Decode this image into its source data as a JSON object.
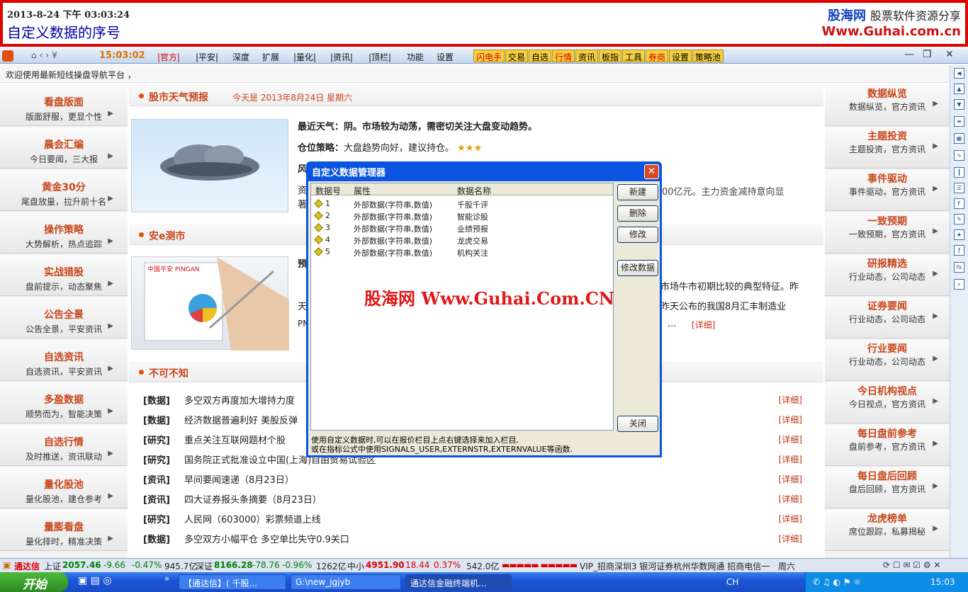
{
  "banner": {
    "date": "2013-8-24 下午 03:03:24",
    "title": "自定义数据的序号",
    "logo_name": "股海网",
    "logo_slogan": "股票软件资源分享",
    "logo_url": "Www.Guhai.com.cn"
  },
  "menubar": {
    "clock": "15:03:02",
    "items": [
      "|官方|",
      "|平安|",
      "深度",
      "扩展",
      "|量化|",
      "|资讯|",
      "|顶栏|",
      "功能",
      "设置"
    ],
    "quick": [
      "闪电手",
      "交易",
      "自选",
      "行情",
      "资讯",
      "板指",
      "工具",
      "券商",
      "设置",
      "策略池"
    ]
  },
  "welcome": "欢迎使用最新短线操盘导航平台 ，",
  "left_nav": [
    {
      "t": "看盘版面",
      "s": "版面舒服，更显个性"
    },
    {
      "t": "晨会汇编",
      "s": "今日要闻，三大报"
    },
    {
      "t": "黄金30分",
      "s": "尾盘放量，拉升前十名"
    },
    {
      "t": "操作策略",
      "s": "大势解析，热点追踪"
    },
    {
      "t": "实战猎股",
      "s": "盘前提示，动态聚焦"
    },
    {
      "t": "公告全景",
      "s": "公告全景，平安资讯"
    },
    {
      "t": "自选资讯",
      "s": "自选资讯，平安资讯"
    },
    {
      "t": "多盈数据",
      "s": "顺势而为，智能决策"
    },
    {
      "t": "自选行情",
      "s": "及时推送，资讯联动"
    },
    {
      "t": "量化股池",
      "s": "量化股池，建仓参考"
    },
    {
      "t": "量膨看盘",
      "s": "量化择时，精准决策"
    }
  ],
  "right_nav": [
    {
      "t": "数据纵览",
      "s": "数据纵览，官方资讯"
    },
    {
      "t": "主题投资",
      "s": "主题投资，官方资讯"
    },
    {
      "t": "事件驱动",
      "s": "事件驱动，官方资讯"
    },
    {
      "t": "一致预期",
      "s": "一致预期，官方资讯"
    },
    {
      "t": "研报精选",
      "s": "行业动态，公司动态"
    },
    {
      "t": "证券要闻",
      "s": "行业动态，公司动态"
    },
    {
      "t": "行业要闻",
      "s": "行业动态，公司动态"
    },
    {
      "t": "今日机构视点",
      "s": "今日视点，官方资讯"
    },
    {
      "t": "每日盘前参考",
      "s": "盘前参考，官方资讯"
    },
    {
      "t": "每日盘后回顾",
      "s": "盘后回顾，官方资讯"
    },
    {
      "t": "龙虎榜单",
      "s": "席位跟踪，私募揭秘"
    }
  ],
  "weather": {
    "section": "股市天气预报",
    "today": "今天是 2013年8月24日 星期六",
    "recent_label": "最近天气：阴。市场较为动荡，需密切关注大盘变动趋势。",
    "position_label": "仓位策略：",
    "position_text": "大盘趋势向好，建议持仓。",
    "stars": "★★★",
    "extra_a": "风",
    "extra_b": "资",
    "extra_c": "著",
    "tail": "00亿元。主力资金减持意向显"
  },
  "ae": {
    "section": "安e测市",
    "lead": "预",
    "line1": "天",
    "line2": "PM",
    "right1": "市场牛市初期比较的典型特征。昨",
    "right2": "昨天公布的我国8月汇丰制造业",
    "ellipsis": "...",
    "more": "[详细]",
    "logo_text": "中国平安 PINGAN"
  },
  "news": {
    "section": "不可不知",
    "more": "[详细]",
    "items": [
      {
        "k": "[数据]",
        "t": "多空双方再度加大增持力度"
      },
      {
        "k": "[数据]",
        "t": "经济数据普遍利好 美股反弹"
      },
      {
        "k": "[研究]",
        "t": "重点关注互联网题材个股"
      },
      {
        "k": "[研究]",
        "t": "国务院正式批准设立中国(上海)自由贸易试验区"
      },
      {
        "k": "[资讯]",
        "t": "早间要闻速递（8月23日）"
      },
      {
        "k": "[资讯]",
        "t": "四大证券报头条摘要（8月23日）"
      },
      {
        "k": "[研究]",
        "t": "人民网（603000）彩票频道上线"
      },
      {
        "k": "[数据]",
        "t": "多空双方小幅平仓 多空单比失守0.9关口"
      }
    ]
  },
  "dialog": {
    "title": "自定义数据管理器",
    "close": "✕",
    "cols": [
      "数据号",
      "属性",
      "数据名称"
    ],
    "rows": [
      {
        "n": "1",
        "a": "外部数据(字符串,数值)",
        "name": "千股千评"
      },
      {
        "n": "2",
        "a": "外部数据(字符串,数值)",
        "name": "智能诊股"
      },
      {
        "n": "3",
        "a": "外部数据(字符串,数值)",
        "name": "业绩预报"
      },
      {
        "n": "4",
        "a": "外部数据(字符串,数值)",
        "name": "龙虎交易"
      },
      {
        "n": "5",
        "a": "外部数据(字符串,数值)",
        "name": "机构关注"
      }
    ],
    "buttons": {
      "new": "新建",
      "del": "删除",
      "edit": "修改",
      "edit_data": "修改数据",
      "close": "关闭"
    },
    "hint1": "使用自定义数据时,可以在报价栏目上点右键选择来加入栏目,",
    "hint2": "或在指标公式中使用SIGNALS_USER,EXTERNSTR,EXTERNVALUE等函数."
  },
  "watermark": "股海网 Www.Guhai.Com.CN",
  "status": {
    "app": "通达信",
    "sh_label": "上证",
    "sh": "2057.46",
    "sh_chg": "-9.66",
    "sh_pct": "-0.47%",
    "sh_amt": "945.7亿",
    "sz_label": "深证",
    "sz": "8166.28",
    "sz_chg": "-78.76",
    "sz_pct": "-0.96%",
    "sz_amt": "1262亿",
    "zx_label": "中小",
    "zx": "4951.90",
    "zx_chg": "18.44",
    "zx_pct": "0.37%",
    "zx_amt": "542.0亿",
    "server": "VIP_招商深圳3 银河证券杭州华数网通 招商电信一",
    "day": "周六"
  },
  "taskbar": {
    "start": "开始",
    "tasks": [
      "【通达信】( 千股...",
      "G:\\new_jgjyb",
      "通达信金融终端机..."
    ],
    "ime": "CH",
    "time": "15:03"
  }
}
